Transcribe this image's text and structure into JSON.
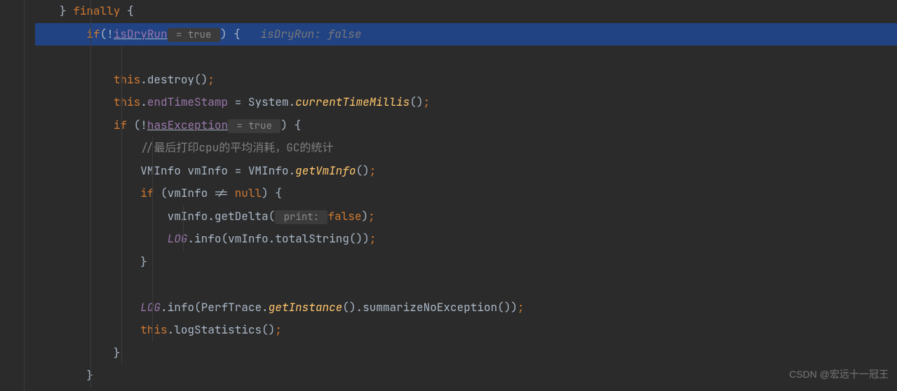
{
  "code": {
    "line1_close": "}",
    "line1_finally": " finally ",
    "line1_brace": "{",
    "line2_if": "if",
    "line2_paren_open": "(",
    "line2_not": "!",
    "line2_isDryRun": "isDryRun",
    "line2_hint_eq": " = true ",
    "line2_paren_close": ")",
    "line2_brace": " {",
    "line2_inline_hint": "isDryRun: false",
    "line4_this": "this",
    "line4_dot": ".",
    "line4_destroy": "destroy",
    "line4_parens": "()",
    "line4_semi": ";",
    "line5_this": "this",
    "line5_dot": ".",
    "line5_endTimeStamp": "endTimeStamp",
    "line5_eq": " = ",
    "line5_System": "System",
    "line5_currentTimeMillis": "currentTimeMillis",
    "line5_parens": "()",
    "line5_semi": ";",
    "line6_if": "if ",
    "line6_paren_open": "(",
    "line6_not": "!",
    "line6_hasException": "hasException",
    "line6_hint_eq": " = true ",
    "line6_paren_close": ")",
    "line6_brace": " {",
    "line7_comment": "//最后打印cpu的平均消耗，GC的统计",
    "line8_VMInfo_type": "VMInfo ",
    "line8_vmInfo": "vmInfo",
    "line8_eq": " = ",
    "line8_VMInfo_class": "VMInfo",
    "line8_dot": ".",
    "line8_getVmInfo": "getVmInfo",
    "line8_parens": "()",
    "line8_semi": ";",
    "line9_if": "if ",
    "line9_paren_open": "(",
    "line9_vmInfo": "vmInfo",
    "line9_neq": " != ",
    "line9_null": "null",
    "line9_paren_close": ")",
    "line9_brace": " {",
    "line10_vmInfo": "vmInfo",
    "line10_dot": ".",
    "line10_getDelta": "getDelta",
    "line10_paren_open": "(",
    "line10_hint_print": " print: ",
    "line10_false": "false",
    "line10_paren_close": ")",
    "line10_semi": ";",
    "line11_LOG": "LOG",
    "line11_dot": ".",
    "line11_info": "info",
    "line11_paren_open": "(",
    "line11_vmInfo": "vmInfo",
    "line11_dot2": ".",
    "line11_totalString": "totalString",
    "line11_parens": "()",
    "line11_paren_close": ")",
    "line11_semi": ";",
    "line12_brace": "}",
    "line14_LOG": "LOG",
    "line14_dot": ".",
    "line14_info": "info",
    "line14_paren_open": "(",
    "line14_PerfTrace": "PerfTrace",
    "line14_dot2": ".",
    "line14_getInstance": "getInstance",
    "line14_parens": "()",
    "line14_dot3": ".",
    "line14_summarize": "summarizeNoException",
    "line14_parens2": "()",
    "line14_paren_close": ")",
    "line14_semi": ";",
    "line15_this": "this",
    "line15_dot": ".",
    "line15_logStatistics": "logStatistics",
    "line15_parens": "()",
    "line15_semi": ";",
    "line16_brace": "}",
    "line17_brace": "}"
  },
  "watermark": "CSDN @宏远十一冠王"
}
